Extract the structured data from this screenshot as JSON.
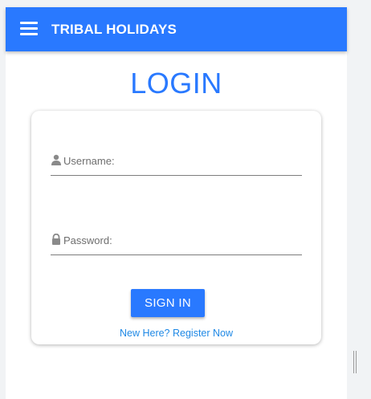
{
  "navbar": {
    "brand": "TRIBAL HOLIDAYS",
    "menu_icon": "hamburger-icon"
  },
  "page": {
    "title": "LOGIN"
  },
  "form": {
    "username_label": "Username:",
    "username_icon": "user-icon",
    "password_label": "Password:",
    "password_icon": "lock-icon",
    "signin_label": "SIGN IN",
    "register_link": "New Here? Register Now"
  },
  "colors": {
    "primary": "#2979ff",
    "link": "#1e88e5"
  }
}
